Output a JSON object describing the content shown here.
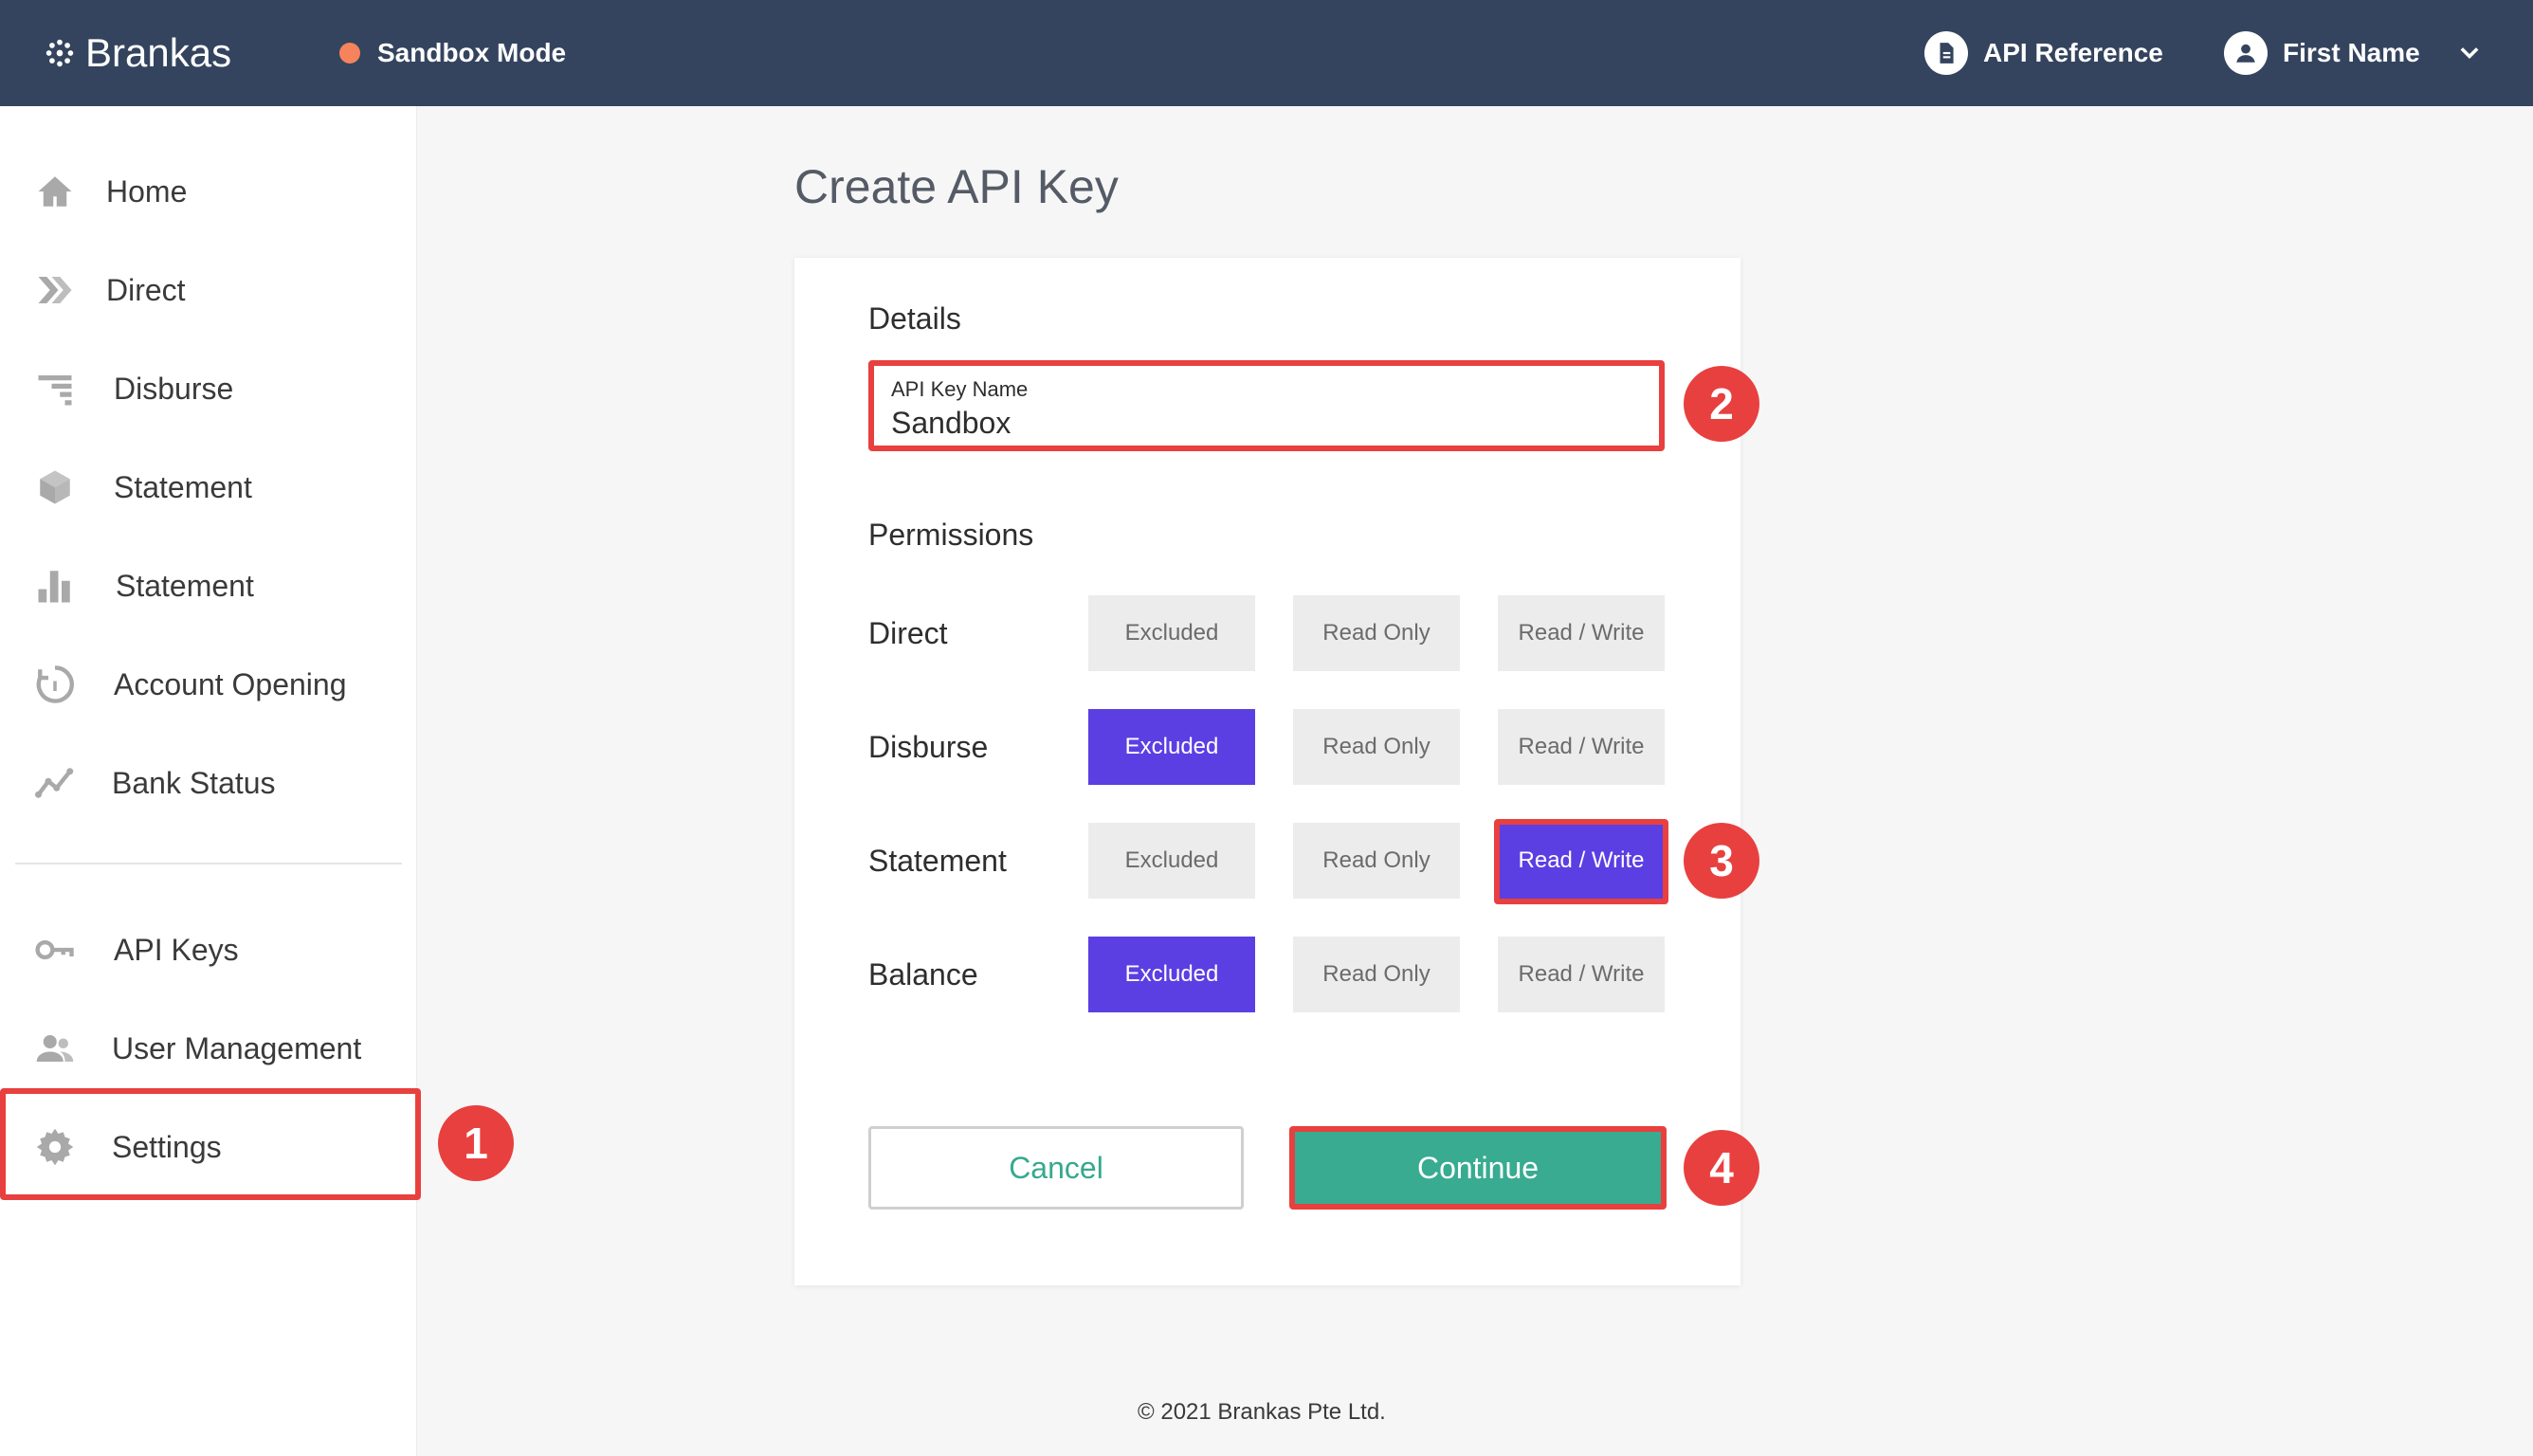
{
  "header": {
    "brand": "Brankas",
    "mode": "Sandbox Mode",
    "api_reference": "API Reference",
    "user_name": "First Name"
  },
  "sidebar": {
    "items": [
      {
        "label": "Home",
        "icon": "home-icon"
      },
      {
        "label": "Direct",
        "icon": "direct-icon"
      },
      {
        "label": "Disburse",
        "icon": "disburse-icon"
      },
      {
        "label": "Statement",
        "icon": "cube-icon"
      },
      {
        "label": "Statement",
        "icon": "bar-chart-icon"
      },
      {
        "label": "Account Opening",
        "icon": "account-opening-icon"
      },
      {
        "label": "Bank Status",
        "icon": "trend-line-icon"
      },
      {
        "label": "API Keys",
        "icon": "key-icon"
      },
      {
        "label": "User Management",
        "icon": "users-icon"
      },
      {
        "label": "Settings",
        "icon": "gear-icon"
      }
    ]
  },
  "page": {
    "title": "Create API Key",
    "details_label": "Details",
    "key_field_label": "API Key Name",
    "key_field_value": "Sandbox",
    "permissions_label": "Permissions",
    "options": [
      "Excluded",
      "Read Only",
      "Read / Write"
    ],
    "rows": [
      {
        "label": "Direct",
        "selected": null
      },
      {
        "label": "Disburse",
        "selected": "Excluded"
      },
      {
        "label": "Statement",
        "selected": "Read / Write"
      },
      {
        "label": "Balance",
        "selected": "Excluded"
      }
    ],
    "cancel": "Cancel",
    "continue": "Continue"
  },
  "annotations": [
    "1",
    "2",
    "3",
    "4"
  ],
  "footer": "© 2021 Brankas Pte Ltd.",
  "colors": {
    "topbar": "#34445e",
    "accent_purple": "#5b3fe3",
    "accent_green": "#38ab91",
    "highlight_red": "#e8403f",
    "sandbox_dot": "#f5835b"
  }
}
